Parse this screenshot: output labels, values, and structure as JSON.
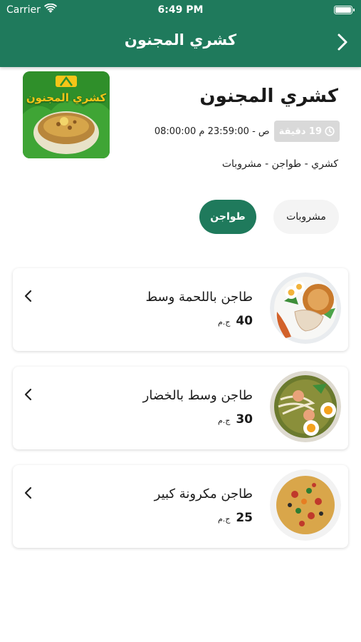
{
  "status_bar": {
    "carrier": "Carrier",
    "time": "6:49 PM"
  },
  "nav": {
    "title": "كشري المجنون",
    "back_icon": "chevron-right-icon"
  },
  "restaurant": {
    "name": "كشري المجنون",
    "logo_text": "كشري المجنون",
    "prep_time": "19 دقيقة",
    "hours": "08:00:00 ص - 23:59:00 م",
    "categories": "كشري - طواجن - مشروبات"
  },
  "tabs": [
    {
      "label": "مشروبات",
      "active": false
    },
    {
      "label": "طواجن",
      "active": true
    }
  ],
  "items": [
    {
      "name": "طاجن باللحمة وسط",
      "price": "40",
      "currency": "ج.م"
    },
    {
      "name": "طاجن وسط بالخضار",
      "price": "30",
      "currency": "ج.م"
    },
    {
      "name": "طاجن مكرونة كبير",
      "price": "25",
      "currency": "ج.م"
    }
  ],
  "colors": {
    "primary": "#1f7a5c",
    "badge": "#d9d9d9",
    "tab_inactive": "#f4f4f4"
  }
}
